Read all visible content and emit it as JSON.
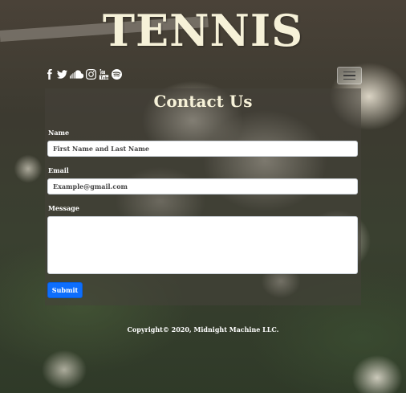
{
  "header": {
    "title": "TENNIS"
  },
  "social_icons": [
    "facebook-icon",
    "twitter-icon",
    "soundcloud-icon",
    "instagram-icon",
    "youtube-icon",
    "spotify-icon"
  ],
  "form": {
    "heading": "Contact Us",
    "name_label": "Name",
    "name_placeholder": "First Name and Last Name",
    "email_label": "Email",
    "email_placeholder": "Example@gmail.com",
    "message_label": "Message",
    "message_placeholder": "",
    "submit_label": "Submit"
  },
  "footer": {
    "copyright": "Copyright© 2020, Midnight Machine LLC."
  },
  "colors": {
    "title": "#f6f1d8",
    "submit": "#0d6efd"
  }
}
